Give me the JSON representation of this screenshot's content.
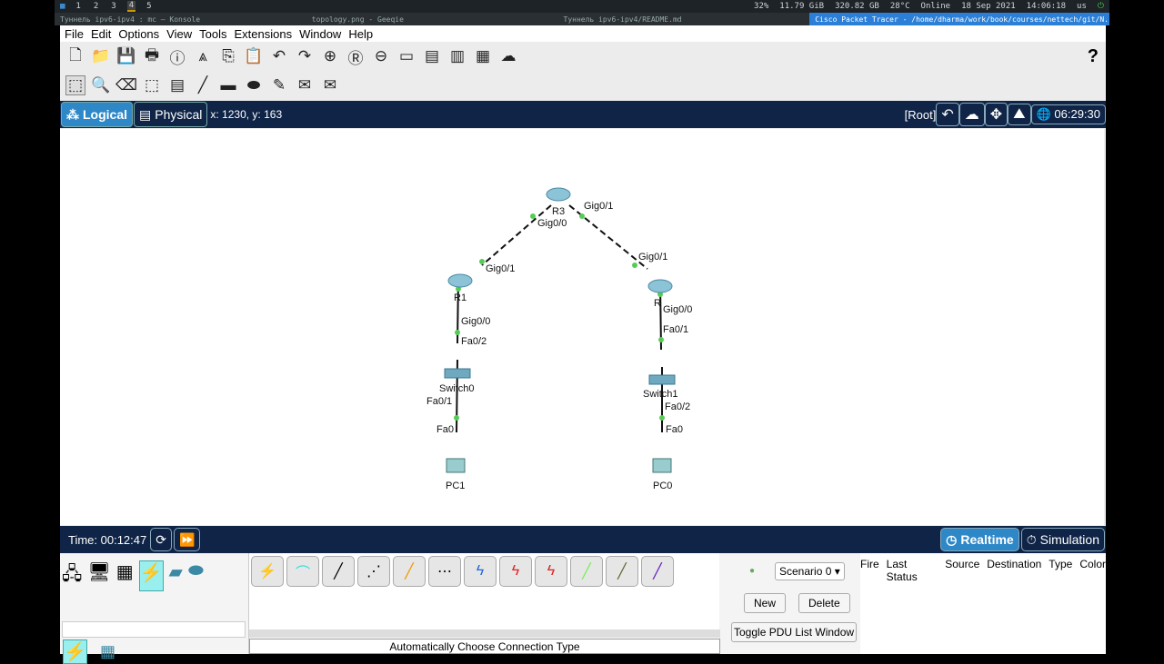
{
  "system_bar": {
    "workspaces": [
      "1",
      "2",
      "3",
      "4",
      "5"
    ],
    "active_workspace": "4",
    "cpu": "32%",
    "memory": "11.79 GiB",
    "disk": "320.82 GB",
    "temp": "28°C",
    "network": "Online",
    "date": "18 Sep 2021",
    "time": "14:06:18",
    "layout": "us"
  },
  "taskbar": [
    "Туннель ipv6-ipv4 : mc — Konsole",
    "topology.png - Geeqie",
    "Туннель ipv6-ipv4/README.md",
    "Cisco Packet Tracer - /home/dharma/work/book/courses/nettech/git/N..."
  ],
  "menu": [
    "File",
    "Edit",
    "Options",
    "View",
    "Tools",
    "Extensions",
    "Window",
    "Help"
  ],
  "help_label": "?",
  "workspace_bar": {
    "logical": "Logical",
    "physical": "Physical",
    "coords": "x: 1230, y: 163",
    "root": "[Root]",
    "clock": "06:29:30"
  },
  "topology": {
    "devices": [
      {
        "name": "R3"
      },
      {
        "name": "R1"
      },
      {
        "name": "R"
      },
      {
        "name": "Switch0"
      },
      {
        "name": "Switch1"
      },
      {
        "name": "PC1"
      },
      {
        "name": "PC0"
      }
    ],
    "ports": [
      "Gig0/1",
      "Gig0/0",
      "Gig0/1",
      "Gig0/1",
      "Gig0/0",
      "Fa0/2",
      "Fa0/1",
      "Fa0",
      "Gig0/0",
      "Fa0/1",
      "Fa0/2",
      "Fa0"
    ]
  },
  "sim": {
    "time": "Time: 00:12:47",
    "realtime": "Realtime",
    "simulation": "Simulation"
  },
  "bottom": {
    "status": "Automatically Choose Connection Type",
    "scenario": "Scenario 0",
    "new": "New",
    "delete": "Delete",
    "toggle": "Toggle PDU List Window",
    "columns": [
      "Fire",
      "Last Status",
      "Source",
      "Destination",
      "Type",
      "Color"
    ]
  },
  "colors": {
    "accent": "#0f2447",
    "tab_active": "#2e88c8"
  }
}
